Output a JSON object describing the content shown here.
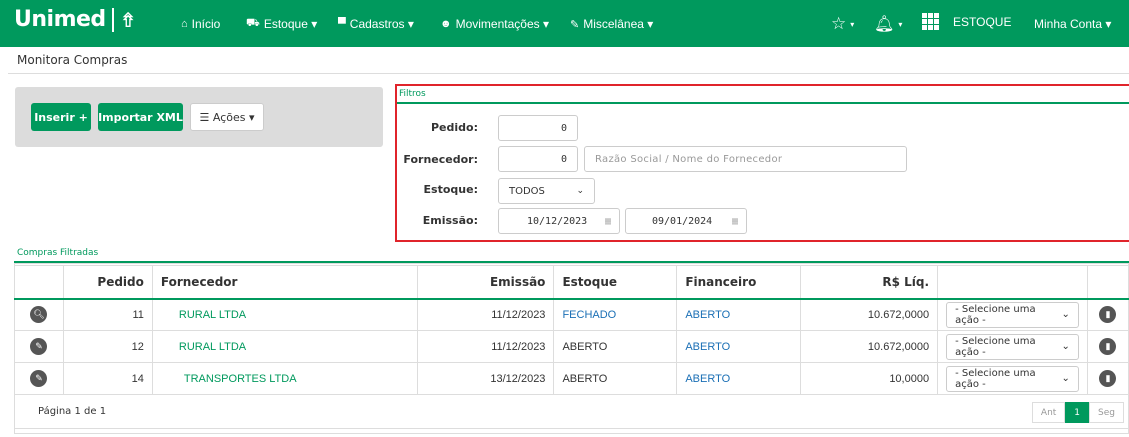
{
  "brand": {
    "name": "Unimed"
  },
  "nav": {
    "items": [
      {
        "icon": "home-icon",
        "label": "Início"
      },
      {
        "icon": "box-icon",
        "label": "Estoque ▾"
      },
      {
        "icon": "folder-icon",
        "label": "Cadastros ▾"
      },
      {
        "icon": "user-icon",
        "label": "Movimentações ▾"
      },
      {
        "icon": "wrench-icon",
        "label": "Miscelânea ▾"
      }
    ],
    "module_label": "ESTOQUE",
    "account_label": "Minha Conta ▾"
  },
  "page": {
    "title": "Monitora Compras"
  },
  "actions": {
    "insert_label": "Inserir +",
    "import_label": "Importar XML",
    "menu_label": "Ações ▾"
  },
  "filters": {
    "title": "Filtros",
    "pedido_label": "Pedido:",
    "pedido_value": "0",
    "fornecedor_label": "Fornecedor:",
    "fornecedor_value": "0",
    "fornecedor_placeholder": "Razão Social / Nome do Fornecedor",
    "estoque_label": "Estoque:",
    "estoque_value": "TODOS",
    "emissao_label": "Emissão:",
    "emissao_start": "10/12/2023",
    "emissao_end": "09/01/2024"
  },
  "table": {
    "title": "Compras Filtradas",
    "headers": [
      "Pedido",
      "Fornecedor",
      "Emissão",
      "Estoque",
      "Financeiro",
      "R$ Líq."
    ],
    "rows": [
      {
        "icon": "search-icon",
        "pedido": "11",
        "fornecedor": "RURAL LTDA",
        "emissao": "11/12/2023",
        "estoque": "FECHADO",
        "financeiro": "ABERTO",
        "liquido": "10.672,0000",
        "action": "- Selecione uma ação -"
      },
      {
        "icon": "pencil-icon",
        "pedido": "12",
        "fornecedor": "RURAL LTDA",
        "emissao": "11/12/2023",
        "estoque": "ABERTO",
        "financeiro": "ABERTO",
        "liquido": "10.672,0000",
        "action": "- Selecione uma ação -"
      },
      {
        "icon": "pencil-icon",
        "pedido": "14",
        "fornecedor": "TRANSPORTES LTDA",
        "emissao": "13/12/2023",
        "estoque": "ABERTO",
        "financeiro": "ABERTO",
        "liquido": "10,0000",
        "action": "- Selecione uma ação -"
      }
    ],
    "page_info": "Página 1 de 1",
    "pager": {
      "prev": "Ant",
      "current": "1",
      "next": "Seg"
    }
  },
  "colors": {
    "brand": "#00995d",
    "highlight": "#e0242b",
    "link_blue": "#1a6fb5"
  }
}
